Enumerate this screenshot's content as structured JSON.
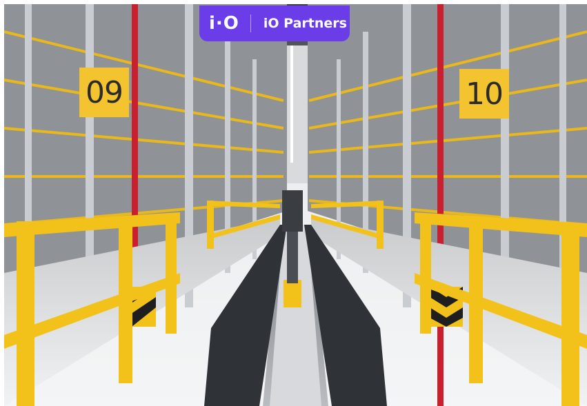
{
  "brand": {
    "mark": "i·O",
    "name": "iO Partners",
    "badge_color": "#6a3de8"
  },
  "signs": {
    "left": "09",
    "right": "10",
    "sign_color": "#f4c430"
  },
  "scene": {
    "description_colors": {
      "railing": "#f2c21b",
      "upright": "#c9ccd0",
      "accent_beam": "#c8202f"
    }
  }
}
